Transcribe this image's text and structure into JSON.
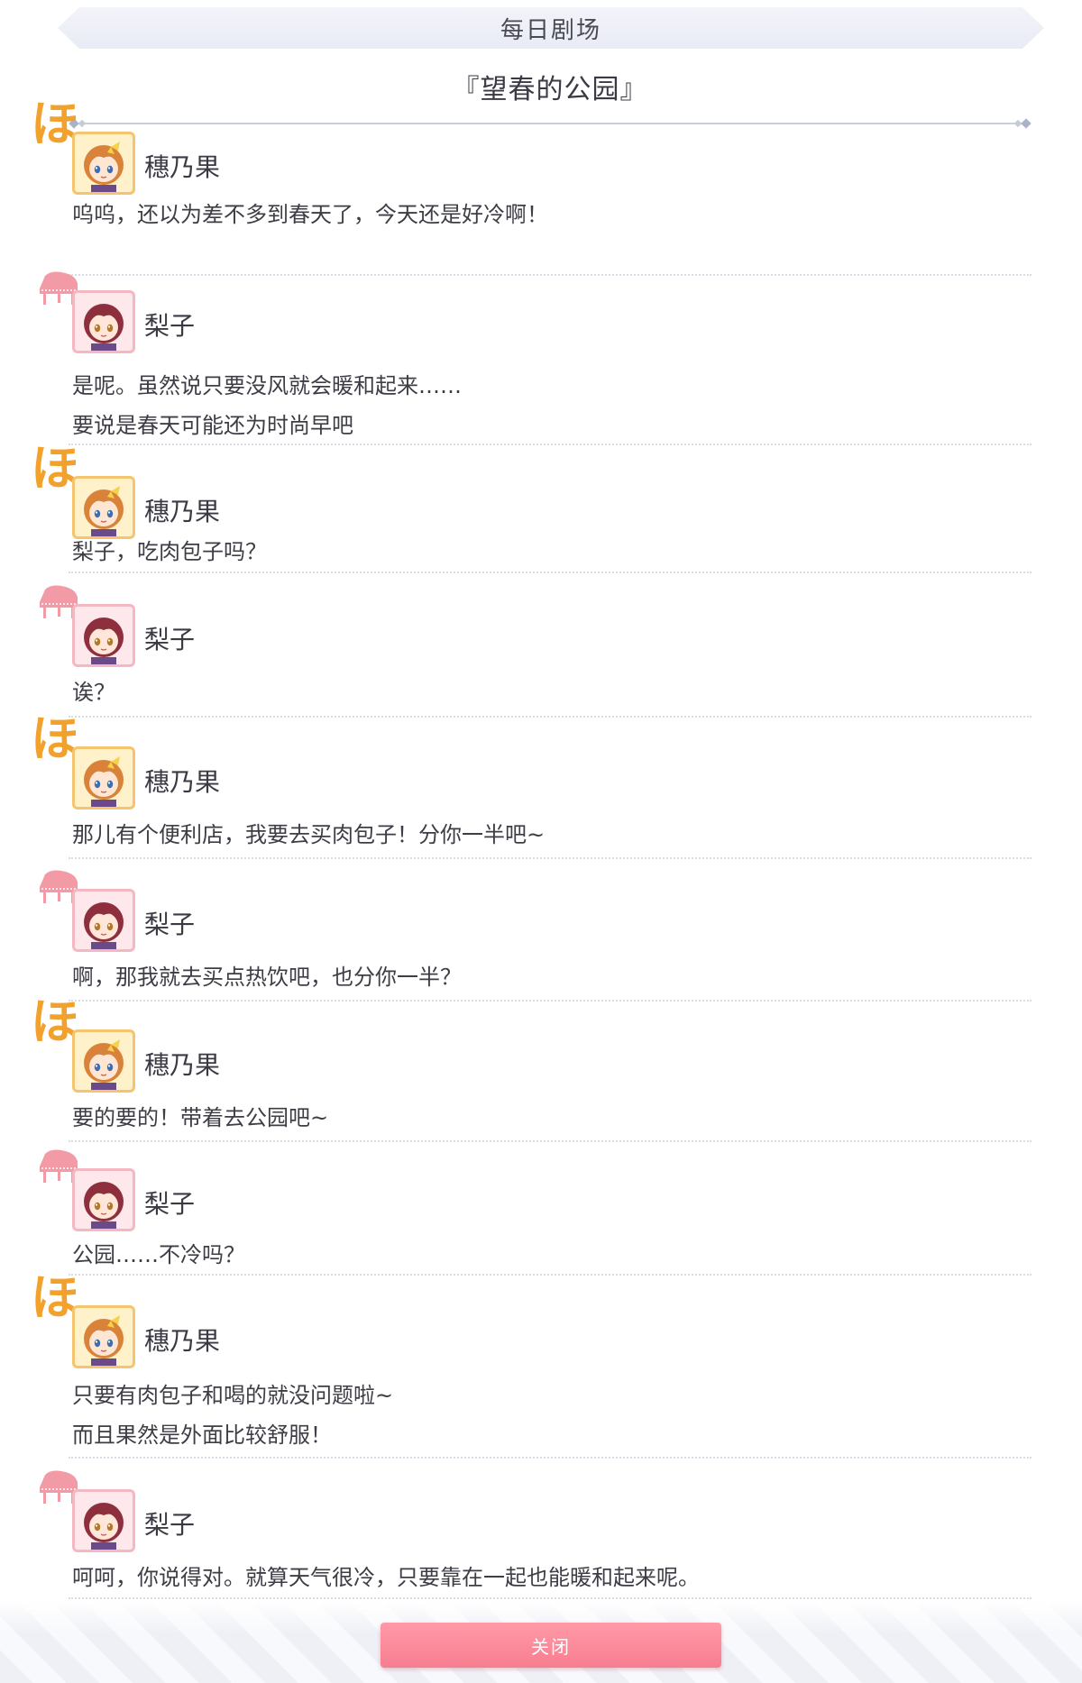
{
  "header": {
    "title": "每日剧场"
  },
  "story": {
    "title": "『望春的公园』"
  },
  "characters": {
    "honoka": {
      "name": "穗乃果",
      "emblem": "ほ",
      "icon": "ho-hiragana-emblem-icon"
    },
    "riko": {
      "name": "梨子",
      "icon": "piano-icon"
    }
  },
  "dialogue": [
    {
      "speaker": "穗乃果",
      "lines": [
        "呜呜，还以为差不多到春天了，今天还是好冷啊！"
      ]
    },
    {
      "speaker": "梨子",
      "lines": [
        "是呢。虽然说只要没风就会暖和起来……",
        "要说是春天可能还为时尚早吧"
      ]
    },
    {
      "speaker": "穗乃果",
      "lines": [
        "梨子，吃肉包子吗？"
      ]
    },
    {
      "speaker": "梨子",
      "lines": [
        "诶？"
      ]
    },
    {
      "speaker": "穗乃果",
      "lines": [
        "那儿有个便利店，我要去买肉包子！分你一半吧~"
      ]
    },
    {
      "speaker": "梨子",
      "lines": [
        "啊，那我就去买点热饮吧，也分你一半？"
      ]
    },
    {
      "speaker": "穗乃果",
      "lines": [
        "要的要的！带着去公园吧~"
      ]
    },
    {
      "speaker": "梨子",
      "lines": [
        "公园……不冷吗？"
      ]
    },
    {
      "speaker": "穗乃果",
      "lines": [
        "只要有肉包子和喝的就没问题啦~",
        "而且果然是外面比较舒服！"
      ]
    },
    {
      "speaker": "梨子",
      "lines": [
        "呵呵，你说得对。就算天气很冷，只要靠在一起也能暖和起来呢。"
      ]
    }
  ],
  "footer": {
    "close_label": "关闭"
  },
  "colors": {
    "honoka_emblem": "#f1a12c",
    "riko_emblem": "#f29aa6",
    "close_button": "#f77d8f"
  }
}
